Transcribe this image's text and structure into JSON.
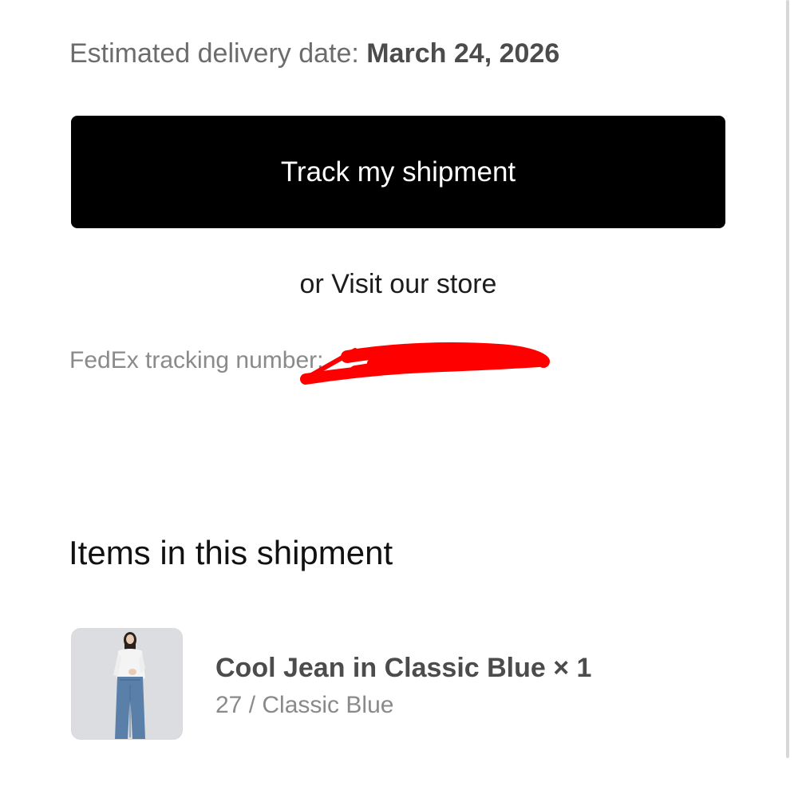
{
  "delivery": {
    "label": "Estimated delivery date: ",
    "date": "March 24, 2026"
  },
  "actions": {
    "track_label": "Track my shipment",
    "store_prefix": "or ",
    "store_link": "Visit our store"
  },
  "tracking": {
    "label": "FedEx tracking number: ",
    "redaction_color": "#ff0000"
  },
  "items_section": {
    "heading": "Items in this shipment",
    "items": [
      {
        "name": "Cool Jean in Classic Blue × 1",
        "variant": "27 / Classic Blue",
        "thumbnail": "product-photo-model-in-white-top-and-blue-jeans"
      }
    ]
  },
  "colors": {
    "button_bg": "#000000",
    "button_text": "#ffffff",
    "secondary_text": "#8a8a8a",
    "primary_text": "#111111"
  }
}
